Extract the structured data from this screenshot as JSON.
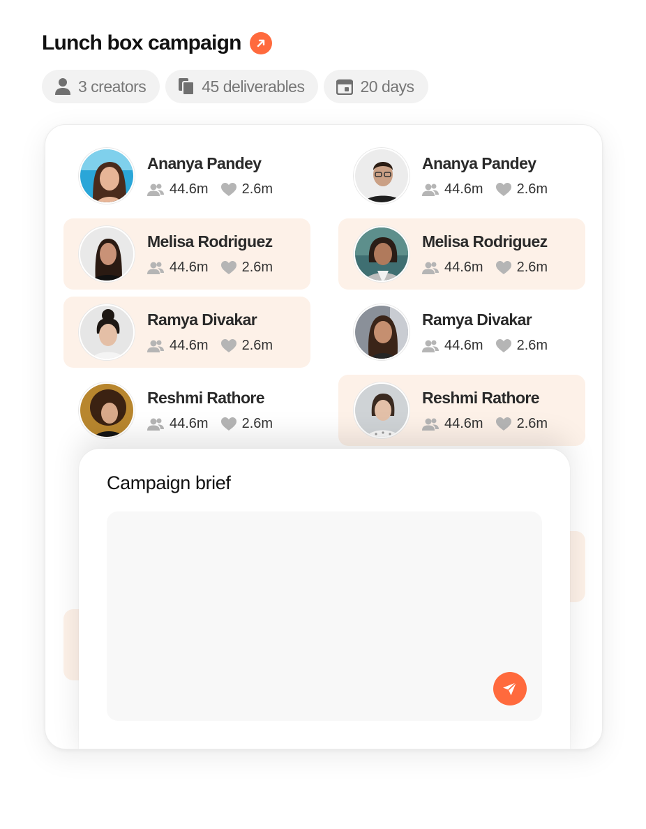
{
  "campaign": {
    "title": "Lunch box campaign",
    "accent_color": "#ff6a3d",
    "link_icon": "arrow-up-right-icon"
  },
  "chips": [
    {
      "icon": "person-icon",
      "label": "3 creators"
    },
    {
      "icon": "deliverables-icon",
      "label": "45 deliverables"
    },
    {
      "icon": "calendar-icon",
      "label": "20 days"
    }
  ],
  "creators": [
    {
      "name": "Ananya Pandey",
      "followers": "44.6m",
      "likes": "2.6m",
      "highlighted": false
    },
    {
      "name": "Ananya Pandey",
      "followers": "44.6m",
      "likes": "2.6m",
      "highlighted": false
    },
    {
      "name": "Melisa Rodriguez",
      "followers": "44.6m",
      "likes": "2.6m",
      "highlighted": true
    },
    {
      "name": "Melisa Rodriguez",
      "followers": "44.6m",
      "likes": "2.6m",
      "highlighted": true
    },
    {
      "name": "Ramya Divakar",
      "followers": "44.6m",
      "likes": "2.6m",
      "highlighted": true
    },
    {
      "name": "Ramya Divakar",
      "followers": "44.6m",
      "likes": "2.6m",
      "highlighted": false
    },
    {
      "name": "Reshmi Rathore",
      "followers": "44.6m",
      "likes": "2.6m",
      "highlighted": false
    },
    {
      "name": "Reshmi Rathore",
      "followers": "44.6m",
      "likes": "2.6m",
      "highlighted": true
    }
  ],
  "brief": {
    "title": "Campaign brief",
    "input_value": "",
    "send_icon": "send-icon"
  },
  "colors": {
    "highlight_bg": "#fdf1e8",
    "chip_bg": "#f2f2f2",
    "stat_icon": "#b5b5b5"
  }
}
